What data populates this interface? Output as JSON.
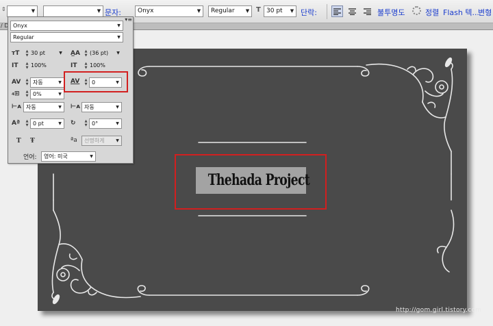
{
  "options_bar": {
    "font_family_label": "문자:",
    "font_family": "Onyx",
    "font_style": "Regular",
    "font_size": "30 pt",
    "paragraph_label": "단락:",
    "opacity_label": "불투명도",
    "style_label": "정렬",
    "flash_label": "Flash 텍...",
    "transform_label": "변형"
  },
  "canvas": {
    "strip_label": "/ Do",
    "title_text": "Thehada Project",
    "watermark": "http://gom.girl.tistory.com",
    "background_color": "#4a4a4a",
    "highlight_color": "#d21f1f"
  },
  "char_panel": {
    "font_family": "Onyx",
    "font_style": "Regular",
    "font_size": "30 pt",
    "leading": "(36 pt)",
    "vertical_scale": "100%",
    "horizontal_scale": "100%",
    "kerning": "자동",
    "tracking": "0",
    "tsume": "0%",
    "aki_left": "자동",
    "aki_right": "자동",
    "baseline_shift": "0 pt",
    "char_rotation": "0°",
    "anti_alias": "선명하게",
    "language_label": "언어:",
    "language": "영어: 미국",
    "icons": {
      "size": "font-size-icon",
      "leading": "leading-icon",
      "vscale": "vertical-scale-icon",
      "hscale": "horizontal-scale-icon",
      "kerning": "kerning-icon",
      "tracking": "tracking-icon",
      "tsume": "tsume-icon",
      "aki_left": "aki-left-icon",
      "aki_right": "aki-right-icon",
      "baseline": "baseline-shift-icon",
      "rotation": "character-rotation-icon",
      "underline": "underline-icon",
      "strikethrough": "strikethrough-icon",
      "antialias": "anti-alias-icon"
    }
  }
}
